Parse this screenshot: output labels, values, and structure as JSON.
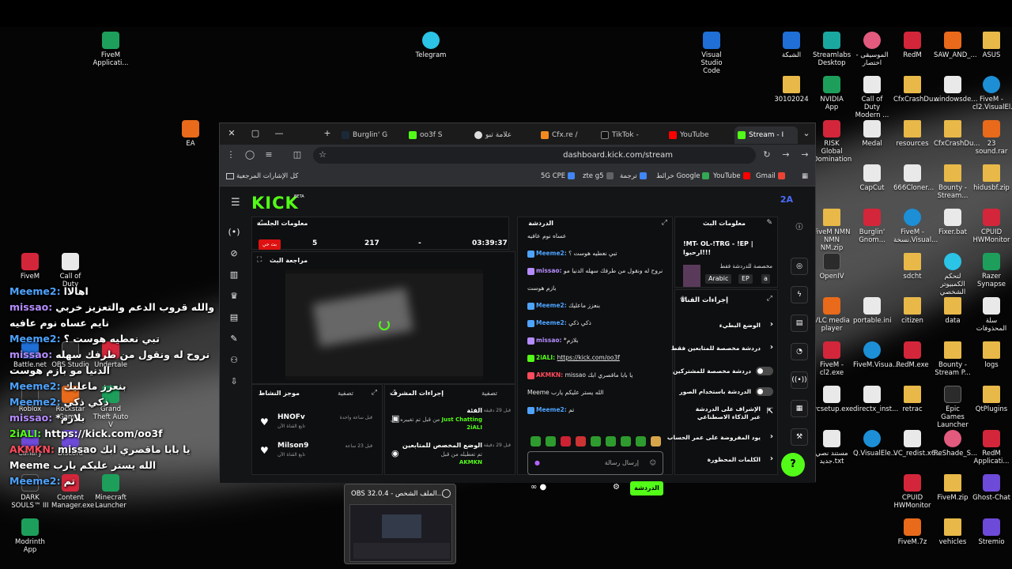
{
  "desktop": {
    "icons": [
      {
        "label": "FiveM Applicati...",
        "icon": "fivem-icon",
        "color": "green"
      },
      {
        "label": "Telegram",
        "icon": "telegram-icon",
        "color": "cyan"
      },
      {
        "label": "Visual Studio Code",
        "icon": "vscode-icon",
        "color": "blue"
      },
      {
        "label": "الشبكة",
        "icon": "network-icon",
        "color": "blue"
      },
      {
        "label": "Streamlabs Desktop",
        "icon": "streamlabs-icon",
        "color": "teal"
      },
      {
        "label": "الموسيقى - اختصار",
        "icon": "music-icon",
        "color": "pink"
      },
      {
        "label": "RedM",
        "icon": "redm-icon",
        "color": "red"
      },
      {
        "label": "SAW_AND_...",
        "icon": "archive-icon",
        "color": "orange"
      },
      {
        "label": "ASUS",
        "icon": "folder-icon",
        "color": "folder"
      },
      {
        "label": "EA",
        "icon": "ea-icon",
        "color": "orange"
      },
      {
        "label": "30102024",
        "icon": "folder-icon",
        "color": "folder"
      },
      {
        "label": "NVIDIA App",
        "icon": "nvidia-icon",
        "color": "green"
      },
      {
        "label": "Call of Duty Modern ...",
        "icon": "file-icon",
        "color": "white"
      },
      {
        "label": "CfxCrashDu...",
        "icon": "folder-icon",
        "color": "folder"
      },
      {
        "label": "windowsde...",
        "icon": "file-icon",
        "color": "white"
      },
      {
        "label": "FiveM - cl2.VisualEl...",
        "icon": "edge-icon",
        "color": "edge"
      },
      {
        "label": "RISK Global Domination",
        "icon": "risk-icon",
        "color": "red"
      },
      {
        "label": "Medal",
        "icon": "medal-icon",
        "color": "white"
      },
      {
        "label": "resources",
        "icon": "folder-icon",
        "color": "folder"
      },
      {
        "label": "CfxCrashDu...",
        "icon": "folder-icon",
        "color": "folder"
      },
      {
        "label": "23 sound.rar",
        "icon": "archive-icon",
        "color": "orange"
      },
      {
        "label": "CapCut",
        "icon": "capcut-icon",
        "color": "white"
      },
      {
        "label": "666Cloner...",
        "icon": "file-icon",
        "color": "white"
      },
      {
        "label": "Bounty - Stream...",
        "icon": "folder-icon",
        "color": "folder"
      },
      {
        "label": "hidusbf.zip",
        "icon": "folder-icon",
        "color": "folder"
      },
      {
        "label": "FiveM NMN NMN NM.zip",
        "icon": "folder-icon",
        "color": "folder"
      },
      {
        "label": "Burglin' Gnom...",
        "icon": "burglin-icon",
        "color": "red"
      },
      {
        "label": "FiveM - نسخة.Visual...",
        "icon": "edge-icon",
        "color": "edge"
      },
      {
        "label": "Fixer.bat",
        "icon": "file-icon",
        "color": "white"
      },
      {
        "label": "CPUID HWMonitor",
        "icon": "cpuid-icon",
        "color": "red"
      },
      {
        "label": "OpenIV",
        "icon": "openiv-icon",
        "color": "dark"
      },
      {
        "label": "sdcht",
        "icon": "folder-icon",
        "color": "folder"
      },
      {
        "label": "لتحكم الكمبيوتر الشخصي",
        "icon": "monitor-icon",
        "color": "cyan"
      },
      {
        "label": "Razer Synapse",
        "icon": "razer-icon",
        "color": "green"
      },
      {
        "label": "FiveM",
        "icon": "fivem-icon",
        "color": "red"
      },
      {
        "label": "Call of Duty",
        "icon": "file-icon",
        "color": "white"
      },
      {
        "label": "VLC media player",
        "icon": "vlc-icon",
        "color": "orange"
      },
      {
        "label": "portable.ini",
        "icon": "file-icon",
        "color": "white"
      },
      {
        "label": "citizen",
        "icon": "folder-icon",
        "color": "folder"
      },
      {
        "label": "data",
        "icon": "folder-icon",
        "color": "folder"
      },
      {
        "label": "سلة المحذوفات",
        "icon": "recycle-icon",
        "color": "white"
      },
      {
        "label": "FiveM - cl2.exe",
        "icon": "fivem-icon",
        "color": "red"
      },
      {
        "label": "FiveM.Visua...",
        "icon": "edge-icon",
        "color": "edge"
      },
      {
        "label": "RedM.exe",
        "icon": "redm-icon",
        "color": "red"
      },
      {
        "label": "Bounty - Stream P...",
        "icon": "folder-icon",
        "color": "folder"
      },
      {
        "label": "logs",
        "icon": "folder-icon",
        "color": "folder"
      },
      {
        "label": "Battle.net",
        "icon": "battlenet-icon",
        "color": "blue"
      },
      {
        "label": "OBS Studio",
        "icon": "obs-icon",
        "color": "dark"
      },
      {
        "label": "Undertale",
        "icon": "undertale-icon",
        "color": "red"
      },
      {
        "label": "Roblox",
        "icon": "roblox-icon",
        "color": "dark"
      },
      {
        "label": "Rockstar Games",
        "icon": "rockstar-icon",
        "color": "orange"
      },
      {
        "label": "Grand Theft Auto V",
        "icon": "gta-icon",
        "color": "green"
      },
      {
        "label": "vcsetup.exe",
        "icon": "file-icon",
        "color": "white"
      },
      {
        "label": "directx_inst...",
        "icon": "file-icon",
        "color": "white"
      },
      {
        "label": "retrac",
        "icon": "folder-icon",
        "color": "folder"
      },
      {
        "label": "Epic Games Launcher",
        "icon": "epic-icon",
        "color": "dark"
      },
      {
        "label": "QtPlugins",
        "icon": "folder-icon",
        "color": "folder"
      },
      {
        "label": "Canary",
        "icon": "canary-icon",
        "color": "purple"
      },
      {
        "label": "Discord",
        "icon": "discord-icon",
        "color": "purple"
      },
      {
        "label": "Minecraft Launcher",
        "icon": "minecraft-icon",
        "color": "green"
      },
      {
        "label": "مستند نصي جديد.txt",
        "icon": "file-icon",
        "color": "white"
      },
      {
        "label": "Q.VisualEle...",
        "icon": "edge-icon",
        "color": "edge"
      },
      {
        "label": "VC_redist.x6...",
        "icon": "file-icon",
        "color": "white"
      },
      {
        "label": "ReShade_S...",
        "icon": "reshade-icon",
        "color": "pink"
      },
      {
        "label": "RedM Applicati...",
        "icon": "redm-icon",
        "color": "red"
      },
      {
        "label": "DARK SOULS™ III",
        "icon": "darksouls-icon",
        "color": "dark"
      },
      {
        "label": "Content Manager.exe",
        "icon": "content-manager-icon",
        "color": "red"
      },
      {
        "label": "CPUID HWMonitor",
        "icon": "cpuid-icon",
        "color": "red"
      },
      {
        "label": "FiveM.zip",
        "icon": "folder-icon",
        "color": "folder"
      },
      {
        "label": "Ghost-Chat",
        "icon": "ghost-chat-icon",
        "color": "purple"
      },
      {
        "label": "Modrinth App",
        "icon": "modrinth-icon",
        "color": "green"
      },
      {
        "label": "FiveM.7z",
        "icon": "archive-icon",
        "color": "orange"
      },
      {
        "label": "vehicles",
        "icon": "folder-icon",
        "color": "folder"
      },
      {
        "label": "Stremio",
        "icon": "stremio-icon",
        "color": "purple"
      }
    ]
  },
  "browser": {
    "tabs": [
      {
        "label": "Burglin' G",
        "icon": "steam-icon",
        "active": false
      },
      {
        "label": "oo3f S",
        "icon": "kick-icon",
        "active": false
      },
      {
        "label": "علامة تبو",
        "icon": "github-icon",
        "active": false
      },
      {
        "label": "Cfx.re /",
        "icon": "cfx-icon",
        "active": false
      },
      {
        "label": "TikTok -",
        "icon": "tiktok-icon",
        "active": false
      },
      {
        "label": "YouTube",
        "icon": "youtube-icon",
        "active": false
      },
      {
        "label": "Stream - I",
        "icon": "kick-icon",
        "active": true
      }
    ],
    "url": "dashboard.kick.com/stream",
    "bookmarks": [
      {
        "label": "Gmail",
        "color": "#ea4335"
      },
      {
        "label": "YouTube",
        "color": "#ff0000"
      },
      {
        "label": "خرائط Google",
        "color": "#34a853"
      },
      {
        "label": "ترجمة",
        "color": "#4285f4"
      },
      {
        "label": "zte g5",
        "color": "#5f6368"
      },
      {
        "label": "5G CPE",
        "color": "#4285f4"
      }
    ],
    "all_bookmarks": "كل الإشارات المرجعية"
  },
  "kick": {
    "logo": "KICK",
    "beta": "BETA",
    "user_initials": "2A",
    "session_info": {
      "title": "معلومات الجلسة",
      "live_badge": "بث حي",
      "stats": [
        "03:39:37",
        "-",
        "217",
        "5"
      ]
    },
    "preview": {
      "title": "مراجعة البث"
    },
    "activity": {
      "title": "موجز النشاط",
      "filter": "تصفية",
      "items": [
        {
          "name": "HNOFv",
          "sub": "تابع القناة الآن",
          "time": "قبل ساعة واحدة"
        },
        {
          "name": "Milson9",
          "sub": "تابع القناة الآن",
          "time": "قبل 23 ساعة"
        }
      ]
    },
    "mod_actions": {
      "title": "إجراءات المشرف",
      "filter": "تصفية",
      "items": [
        {
          "t1": "الفئة",
          "t2": "من قبل تم تغييره إلى",
          "t3": "Just Chatting",
          "who": "2iALI",
          "time": "قبل 29 دقيقة"
        },
        {
          "t1": "الوضع المخصص للمتابعين",
          "t2": "تم تعطيله من قبل",
          "t3": "",
          "who": "AKMKN",
          "time": "قبل 29 دقيقة"
        }
      ]
    },
    "chat": {
      "title": "الدردشة",
      "messages": [
        {
          "user": "",
          "text": "عساه نوم عافيه",
          "color": "#e6e6e6"
        },
        {
          "user": "Meeme2:",
          "text": "تبي نعطيه هوست ؟",
          "color": "#4ea3ff"
        },
        {
          "user": "missao:",
          "text": "نروح له ونقول من طرفك سهله الدنيا مو",
          "color": "#b58cff"
        },
        {
          "user": "",
          "text": "بازم هوست",
          "color": "#e6e6e6"
        },
        {
          "user": "Meeme2:",
          "text": "بنعزز ماعليك",
          "color": "#4ea3ff"
        },
        {
          "user": "Meeme2:",
          "text": "ذكي ذكي",
          "color": "#4ea3ff"
        },
        {
          "user": "missao:",
          "text": "*بلازم",
          "color": "#b58cff"
        },
        {
          "user": "2iALI:",
          "text": "https://kick.com/oo3f",
          "color": "#53fc18"
        },
        {
          "user": "AKMKN:",
          "text": "missao يا بابا ماقصري ابك",
          "color": "#ff4b5c"
        },
        {
          "user": "",
          "text": "Meeme الله يستر عليكم يارب",
          "color": "#e6e6e6"
        },
        {
          "user": "Meeme2:",
          "text": "تم",
          "color": "#4ea3ff"
        }
      ],
      "placeholder": "إرسال رسالة",
      "send_label": "الدردشة"
    },
    "stream_info": {
      "title": "معلومات البث",
      "stream_title": "!MT- OL-!TRG - !EP | ارحبوا!!!",
      "category": "مخصصة للدردشة فقط",
      "tags": [
        "Arabic",
        "EP",
        "a"
      ]
    },
    "channel_actions": {
      "title": "إجراءات القناة",
      "items": [
        {
          "label": "الوضع البطيء",
          "control": "chevron"
        },
        {
          "label": "دردشة مخصصة للمتابعين فقط",
          "control": "chevron"
        },
        {
          "label": "دردشة مخصصة للمشتركين",
          "control": "toggle"
        },
        {
          "label": "الدردشة باستخدام الصور",
          "control": "toggle"
        },
        {
          "label": "الإشراف على الدردشة عبر الذكاء الاصطناعي",
          "control": "external"
        },
        {
          "label": "يود المفروضة على عمر الحساب",
          "control": "chevron"
        },
        {
          "label": "الكلمات المحظورة",
          "control": "chevron"
        }
      ]
    }
  },
  "overlay_chat": [
    {
      "user": "Meeme2:",
      "text": "اهالاا",
      "color": "#4ea3ff"
    },
    {
      "user": "missao:",
      "text": "والله قروب الدعم والتعزيز خربي",
      "color": "#b58cff"
    },
    {
      "user": "",
      "text": "نايم عساه نوم عافيه",
      "color": "#ffffff"
    },
    {
      "user": "Meeme2:",
      "text": "تبي نعطيه هوست ؟",
      "color": "#4ea3ff"
    },
    {
      "user": "missao:",
      "text": "نروح له ونقول من طرفك سهله",
      "color": "#b58cff"
    },
    {
      "user": "",
      "text": "الدنيا مو بازم هوست",
      "color": "#ffffff"
    },
    {
      "user": "Meeme2:",
      "text": "بنعزز ماعليك",
      "color": "#4ea3ff"
    },
    {
      "user": "Meeme2:",
      "text": "ذكي ذكي",
      "color": "#4ea3ff"
    },
    {
      "user": "missao:",
      "text": "*بلازم",
      "color": "#b58cff"
    },
    {
      "user": "2iALI:",
      "text": "https://kick.com/oo3f",
      "color": "#53fc18"
    },
    {
      "user": "AKMKN:",
      "text": "missao يا بابا ماقصري ابك",
      "color": "#ff4b5c"
    },
    {
      "user": "",
      "text": "Meeme الله يستر عليكم يارب",
      "color": "#ffffff"
    },
    {
      "user": "Meeme2:",
      "text": "تم",
      "color": "#4ea3ff"
    }
  ],
  "taskbar_preview": {
    "title": "OBS 32.0.4 - الملف الشخص..."
  }
}
